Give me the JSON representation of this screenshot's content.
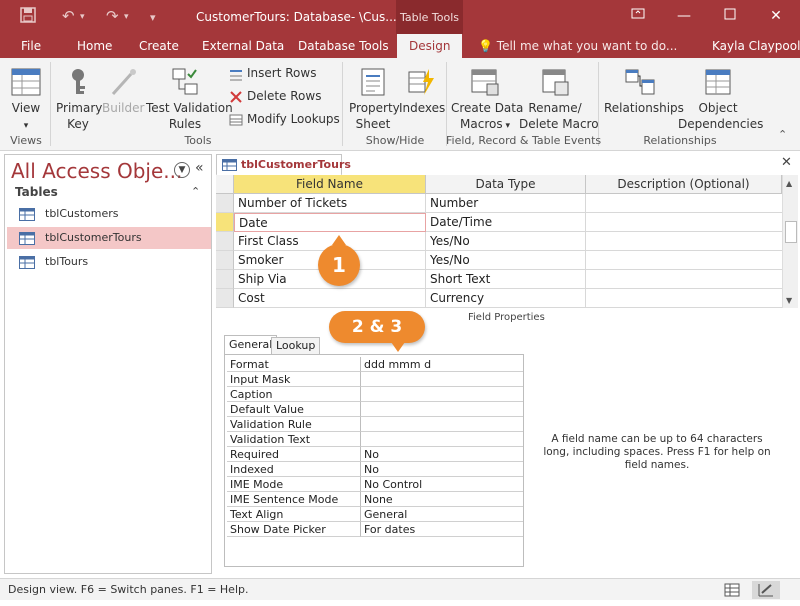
{
  "titlebar": {
    "title": "CustomerTours: Database- \\Cus...",
    "context_tab": "Table Tools"
  },
  "tabs": {
    "file": "File",
    "home": "Home",
    "create": "Create",
    "external": "External Data",
    "dbtools": "Database Tools",
    "design": "Design",
    "tellme": "Tell me what you want to do...",
    "user": "Kayla Claypool"
  },
  "ribbon": {
    "view": "View",
    "primary_key_1": "Primary",
    "primary_key_2": "Key",
    "builder": "Builder",
    "test_validation_1": "Test Validation",
    "test_validation_2": "Rules",
    "insert_rows": "Insert Rows",
    "delete_rows": "Delete Rows",
    "modify_lookups": "Modify Lookups",
    "property_sheet_1": "Property",
    "property_sheet_2": "Sheet",
    "indexes": "Indexes",
    "create_macros_1": "Create Data",
    "create_macros_2": "Macros",
    "rename_macro_1": "Rename/",
    "rename_macro_2": "Delete Macro",
    "relationships": "Relationships",
    "object_dep_1": "Object",
    "object_dep_2": "Dependencies",
    "group_views": "Views",
    "group_tools": "Tools",
    "group_showhide": "Show/Hide",
    "group_events": "Field, Record & Table Events",
    "group_relationships": "Relationships"
  },
  "nav": {
    "title": "All Access Obje...",
    "section": "Tables",
    "items": [
      {
        "label": "tblCustomers"
      },
      {
        "label": "tblCustomerTours"
      },
      {
        "label": "tblTours"
      }
    ]
  },
  "doc": {
    "tab": "tblCustomerTours"
  },
  "grid": {
    "headers": {
      "field": "Field Name",
      "type": "Data Type",
      "desc": "Description (Optional)"
    },
    "rows": [
      {
        "field": "Number of Tickets",
        "type": "Number"
      },
      {
        "field": "Date",
        "type": "Date/Time"
      },
      {
        "field": "First Class",
        "type": "Yes/No"
      },
      {
        "field": "Smoker",
        "type": "Yes/No"
      },
      {
        "field": "Ship Via",
        "type": "Short Text"
      },
      {
        "field": "Cost",
        "type": "Currency"
      }
    ]
  },
  "field_properties": {
    "label": "Field Properties",
    "tab_general": "General",
    "tab_lookup": "Lookup",
    "rows": [
      {
        "label": "Format",
        "value": "ddd mmm d"
      },
      {
        "label": "Input Mask",
        "value": ""
      },
      {
        "label": "Caption",
        "value": ""
      },
      {
        "label": "Default Value",
        "value": ""
      },
      {
        "label": "Validation Rule",
        "value": ""
      },
      {
        "label": "Validation Text",
        "value": ""
      },
      {
        "label": "Required",
        "value": "No"
      },
      {
        "label": "Indexed",
        "value": "No"
      },
      {
        "label": "IME Mode",
        "value": "No Control"
      },
      {
        "label": "IME Sentence Mode",
        "value": "None"
      },
      {
        "label": "Text Align",
        "value": "General"
      },
      {
        "label": "Show Date Picker",
        "value": "For dates"
      }
    ],
    "help": "A field name can be up to 64 characters long, including spaces. Press F1 for help on field names."
  },
  "callouts": {
    "one": "1",
    "two_three": "2 & 3"
  },
  "status": {
    "text": "Design view.  F6 = Switch panes.  F1 = Help."
  },
  "colors": {
    "accent": "#a4373a",
    "callout": "#ee8a2e",
    "selection_header": "#f7e37a"
  }
}
